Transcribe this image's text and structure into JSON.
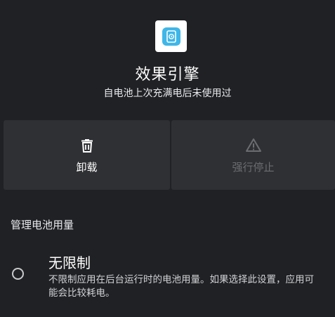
{
  "app": {
    "name": "效果引擎",
    "subtitle": "自电池上次充满电后未使用过",
    "icon": "effect-engine-app-icon",
    "accent_color": "#3fb6e8"
  },
  "actions": {
    "uninstall_label": "卸载",
    "uninstall_icon": "trash-icon",
    "force_stop_label": "强行停止",
    "force_stop_icon": "warning-icon",
    "force_stop_enabled": false
  },
  "battery": {
    "section_title": "管理电池用量",
    "options": [
      {
        "title": "无限制",
        "description": "不限制应用在后台运行时的电池用量。如果选择此设置，应用可能会比较耗电。",
        "selected": false
      }
    ]
  }
}
